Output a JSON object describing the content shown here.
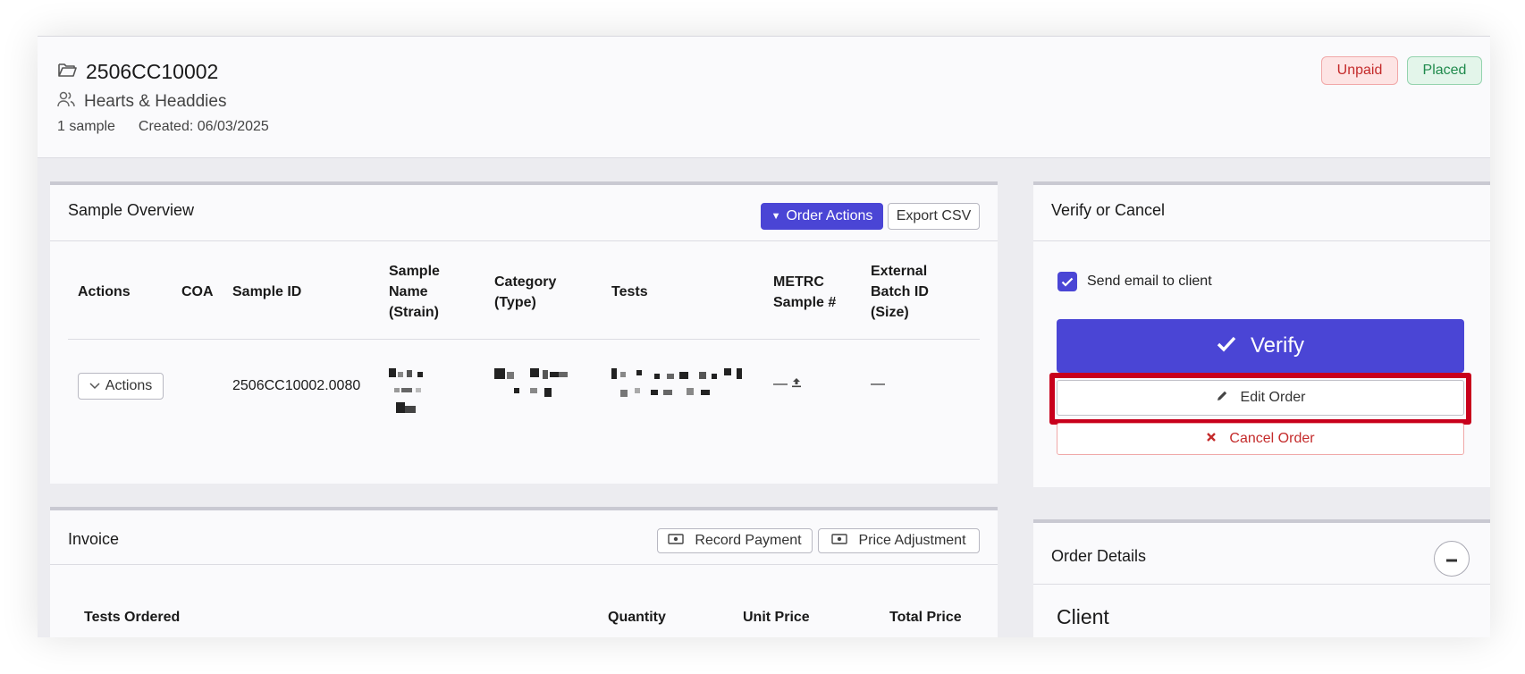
{
  "header": {
    "order_id": "2506CC10002",
    "client_name": "Hearts & Headdies",
    "sample_count": "1 sample",
    "created": "Created: 06/03/2025",
    "badges": {
      "payment": "Unpaid",
      "status": "Placed"
    }
  },
  "sample_overview": {
    "title": "Sample Overview",
    "order_actions_label": "Order Actions",
    "export_label": "Export CSV",
    "columns": {
      "actions": "Actions",
      "coa": "COA",
      "sample_id": "Sample ID",
      "sample_name_1": "Sample",
      "sample_name_2": "Name",
      "sample_name_3": "(Strain)",
      "category_1": "Category",
      "category_2": "(Type)",
      "tests": "Tests",
      "metrc_1": "METRC",
      "metrc_2": "Sample #",
      "ext_1": "External",
      "ext_2": "Batch ID",
      "ext_3": "(Size)"
    },
    "row": {
      "actions_label": "Actions",
      "sample_id": "2506CC10002.0080",
      "metrc": "—",
      "external": "—"
    }
  },
  "invoice": {
    "title": "Invoice",
    "record_payment_label": "Record Payment",
    "price_adjustment_label": "Price Adjustment",
    "columns": {
      "tests_ordered": "Tests Ordered",
      "quantity": "Quantity",
      "unit_price": "Unit Price",
      "total_price": "Total Price"
    }
  },
  "verify": {
    "title": "Verify or Cancel",
    "send_email_label": "Send email to client",
    "send_email_checked": true,
    "verify_label": "Verify",
    "edit_label": "Edit Order",
    "cancel_label": "Cancel Order"
  },
  "order_details": {
    "title": "Order Details",
    "client_heading": "Client"
  },
  "colors": {
    "primary": "#4a45d5",
    "danger": "#c42b2b",
    "success": "#1f8a4c",
    "highlight": "#c8001c"
  }
}
